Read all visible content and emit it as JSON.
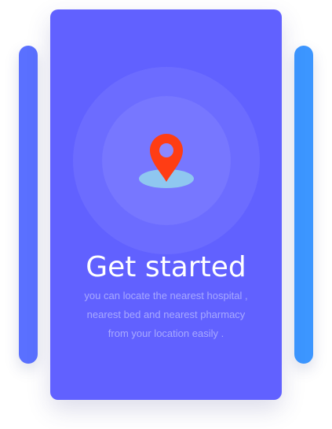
{
  "onboarding": {
    "title": "Get started",
    "description_lines": [
      "you can locate the nearest hospital ,",
      "nearest bed and nearest pharmacy",
      "from your location easily ."
    ],
    "icon": "location-pin-icon"
  },
  "colors": {
    "card_background": "#6161ff",
    "ring_outer": "#6c6cff",
    "ring_inner": "#7777ff",
    "pin": "#ff3d14",
    "pin_base": "#8fc7f0",
    "side_card_left": "#5a70ff",
    "side_card_right": "#3c96ff"
  }
}
